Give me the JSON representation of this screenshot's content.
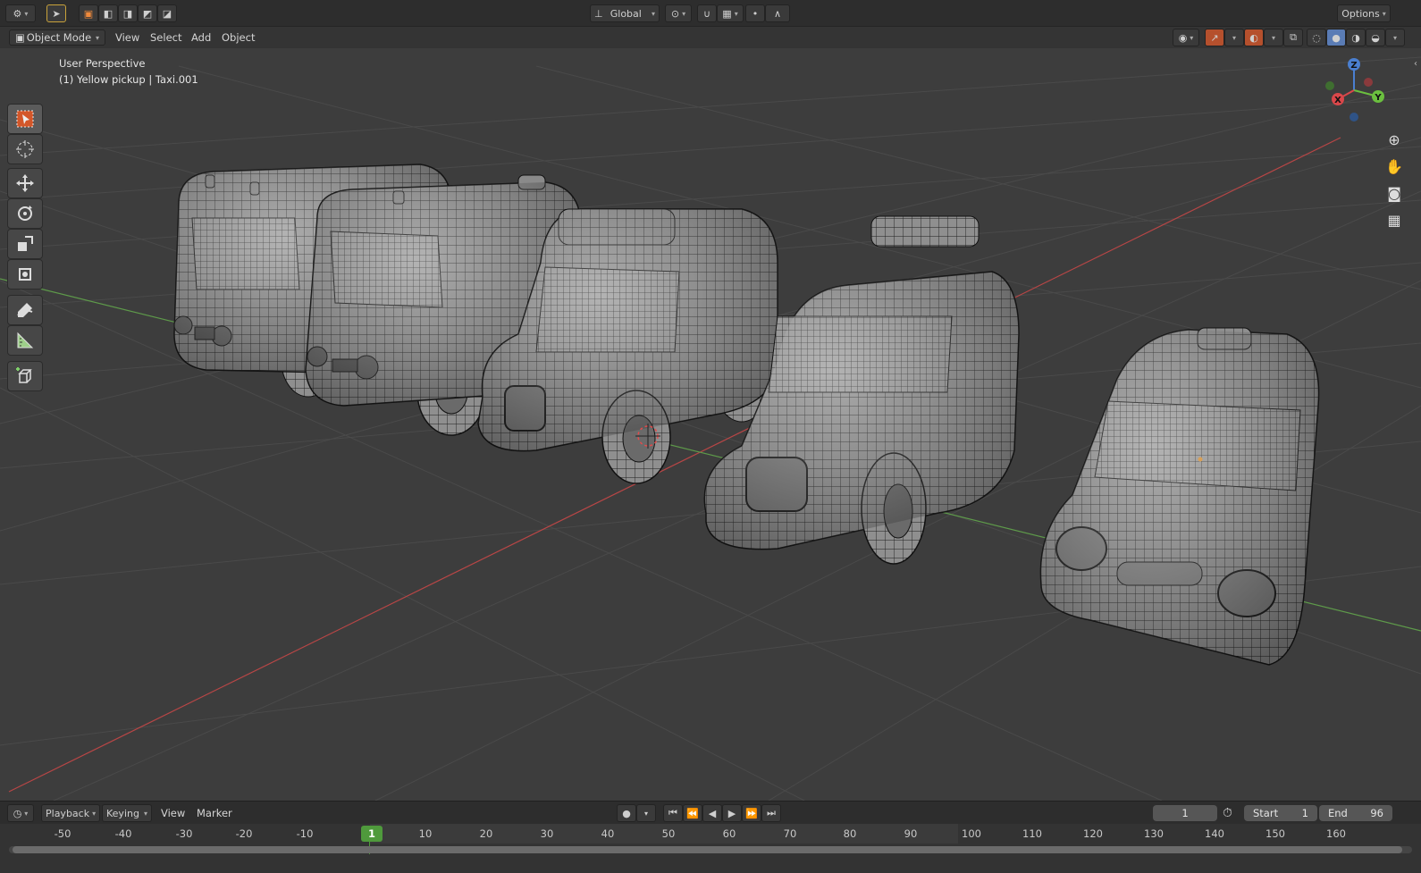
{
  "header": {
    "transform_orientation": "Global",
    "options_label": "Options"
  },
  "viewport_header": {
    "mode": "Object Mode",
    "menus": [
      "View",
      "Select",
      "Add",
      "Object"
    ]
  },
  "viewport": {
    "view_name": "User Perspective",
    "active_object": "(1) Yellow pickup | Taxi.001"
  },
  "gizmo": {
    "x": "X",
    "y": "Y",
    "z": "Z"
  },
  "tools": [
    {
      "name": "select-box-tool",
      "icon": "select-box-icon"
    },
    {
      "name": "cursor-tool",
      "icon": "cursor-icon"
    },
    {
      "name": "move-tool",
      "icon": "move-icon"
    },
    {
      "name": "rotate-tool",
      "icon": "rotate-icon"
    },
    {
      "name": "scale-tool",
      "icon": "scale-icon"
    },
    {
      "name": "transform-tool",
      "icon": "transform-icon"
    },
    {
      "name": "annotate-tool",
      "icon": "annotate-icon"
    },
    {
      "name": "measure-tool",
      "icon": "measure-icon"
    },
    {
      "name": "add-cube-tool",
      "icon": "add-cube-icon"
    }
  ],
  "timeline": {
    "menus": [
      "Playback",
      "Keying",
      "View",
      "Marker"
    ],
    "current_frame": "1",
    "start_label": "Start",
    "start_value": "1",
    "end_label": "End",
    "end_value": "96",
    "ruler_labels": [
      "-50",
      "-40",
      "-30",
      "-20",
      "-10",
      "1",
      "10",
      "20",
      "30",
      "40",
      "50",
      "60",
      "70",
      "80",
      "90",
      "100",
      "110",
      "120",
      "130",
      "140",
      "150",
      "160"
    ]
  },
  "colors": {
    "x_axis": "#c24545",
    "y_axis": "#5e9a4a",
    "active_tool": "#e0652b",
    "current_frame": "#4f9a3c"
  }
}
